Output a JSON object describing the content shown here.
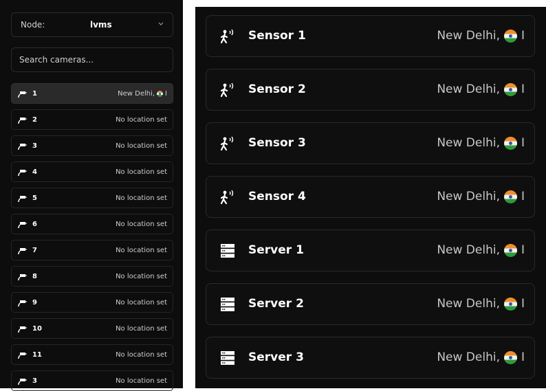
{
  "node_selector": {
    "label": "Node:",
    "value": "lvms"
  },
  "search": {
    "placeholder": "Search cameras..."
  },
  "cameras": [
    {
      "name": "1",
      "location": "New Delhi, ",
      "flag": true,
      "active": true
    },
    {
      "name": "2",
      "location": "No location set"
    },
    {
      "name": "3",
      "location": "No location set"
    },
    {
      "name": "4",
      "location": "No location set"
    },
    {
      "name": "5",
      "location": "No location set"
    },
    {
      "name": "6",
      "location": "No location set"
    },
    {
      "name": "7",
      "location": "No location set"
    },
    {
      "name": "8",
      "location": "No location set"
    },
    {
      "name": "9",
      "location": "No location set"
    },
    {
      "name": "10",
      "location": "No location set"
    },
    {
      "name": "11",
      "location": "No location set"
    },
    {
      "name": "3",
      "location": "No location set"
    }
  ],
  "devices": [
    {
      "name": "Sensor 1",
      "type": "sensor",
      "icon": "motion-sensor-icon",
      "location": "New Delhi,",
      "suffix": "I"
    },
    {
      "name": "Sensor 2",
      "type": "sensor",
      "icon": "motion-sensor-icon",
      "location": "New Delhi,",
      "suffix": "I"
    },
    {
      "name": "Sensor 3",
      "type": "sensor",
      "icon": "motion-sensor-icon",
      "location": "New Delhi,",
      "suffix": "I"
    },
    {
      "name": "Sensor 4",
      "type": "sensor",
      "icon": "motion-sensor-icon",
      "location": "New Delhi,",
      "suffix": "I"
    },
    {
      "name": "Server 1",
      "type": "server",
      "icon": "server-icon",
      "location": "New Delhi,",
      "suffix": "I"
    },
    {
      "name": "Server 2",
      "type": "server",
      "icon": "server-icon",
      "location": "New Delhi,",
      "suffix": "I"
    },
    {
      "name": "Server 3",
      "type": "server",
      "icon": "server-icon",
      "location": "New Delhi,",
      "suffix": "I"
    }
  ],
  "colors": {
    "background": "#0d0d0d",
    "row_border": "#2a2a2a",
    "active_row": "#2a2a2a",
    "flag_saffron": "#ef8f2b",
    "flag_green": "#2f9a3a"
  }
}
